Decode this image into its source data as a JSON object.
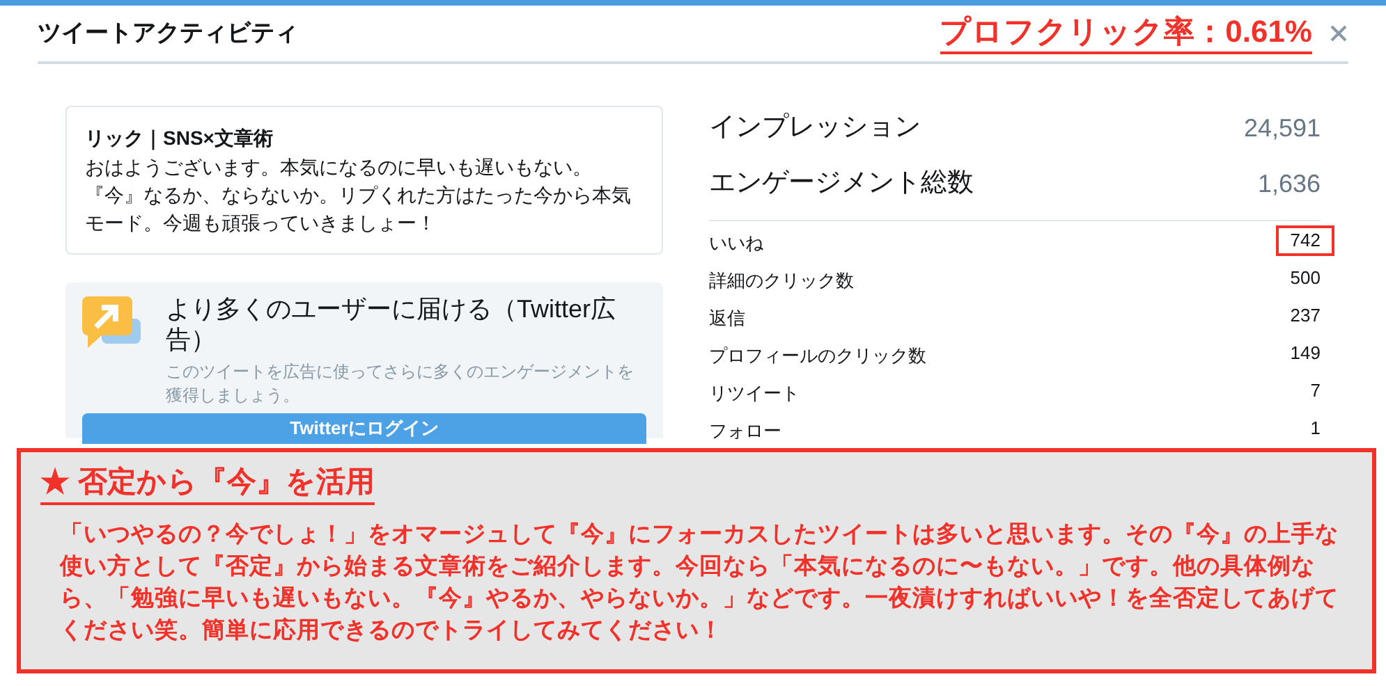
{
  "dialog": {
    "title": "ツイートアクティビティ"
  },
  "tweet": {
    "author": "リック｜SNS×文章術",
    "text": "おはようございます。本気になるのに早いも遅いもない。『今』なるか、ならないか。リプくれた方はたった今から本気モード。今週も頑張っていきましょー！"
  },
  "promo": {
    "title": "より多くのユーザーに届ける（Twitter広告）",
    "description": "このツイートを広告に使ってさらに多くのエンゲージメントを獲得しましょう。",
    "button": "Twitterにログイン"
  },
  "summary": [
    {
      "label": "インプレッション",
      "value": "24,591"
    },
    {
      "label": "エンゲージメント総数",
      "value": "1,636"
    }
  ],
  "metrics": [
    {
      "label": "いいね",
      "value": "742",
      "highlighted": true
    },
    {
      "label": "詳細のクリック数",
      "value": "500",
      "highlighted": false
    },
    {
      "label": "返信",
      "value": "237",
      "highlighted": false
    },
    {
      "label": "プロフィールのクリック数",
      "value": "149",
      "highlighted": false
    },
    {
      "label": "リツイート",
      "value": "7",
      "highlighted": false
    },
    {
      "label": "フォロー",
      "value": "1",
      "highlighted": false
    }
  ],
  "annotation": {
    "headline": "プロフクリック率：0.61%",
    "note_title": "★ 否定から『今』を活用",
    "note_text": "「いつやるの？今でしょ！」をオマージュして『今』にフォーカスしたツイートは多いと思います。その『今』の上手な使い方として『否定』から始まる文章術をご紹介します。今回なら「本気になるのに〜もない。」です。他の具体例なら、「勉強に早いも遅いもない。『今』やるか、やらないか。」などです。一夜漬けすればいいや！を全否定してあげてください笑。簡単に応用できるのでトライしてみてください！"
  }
}
